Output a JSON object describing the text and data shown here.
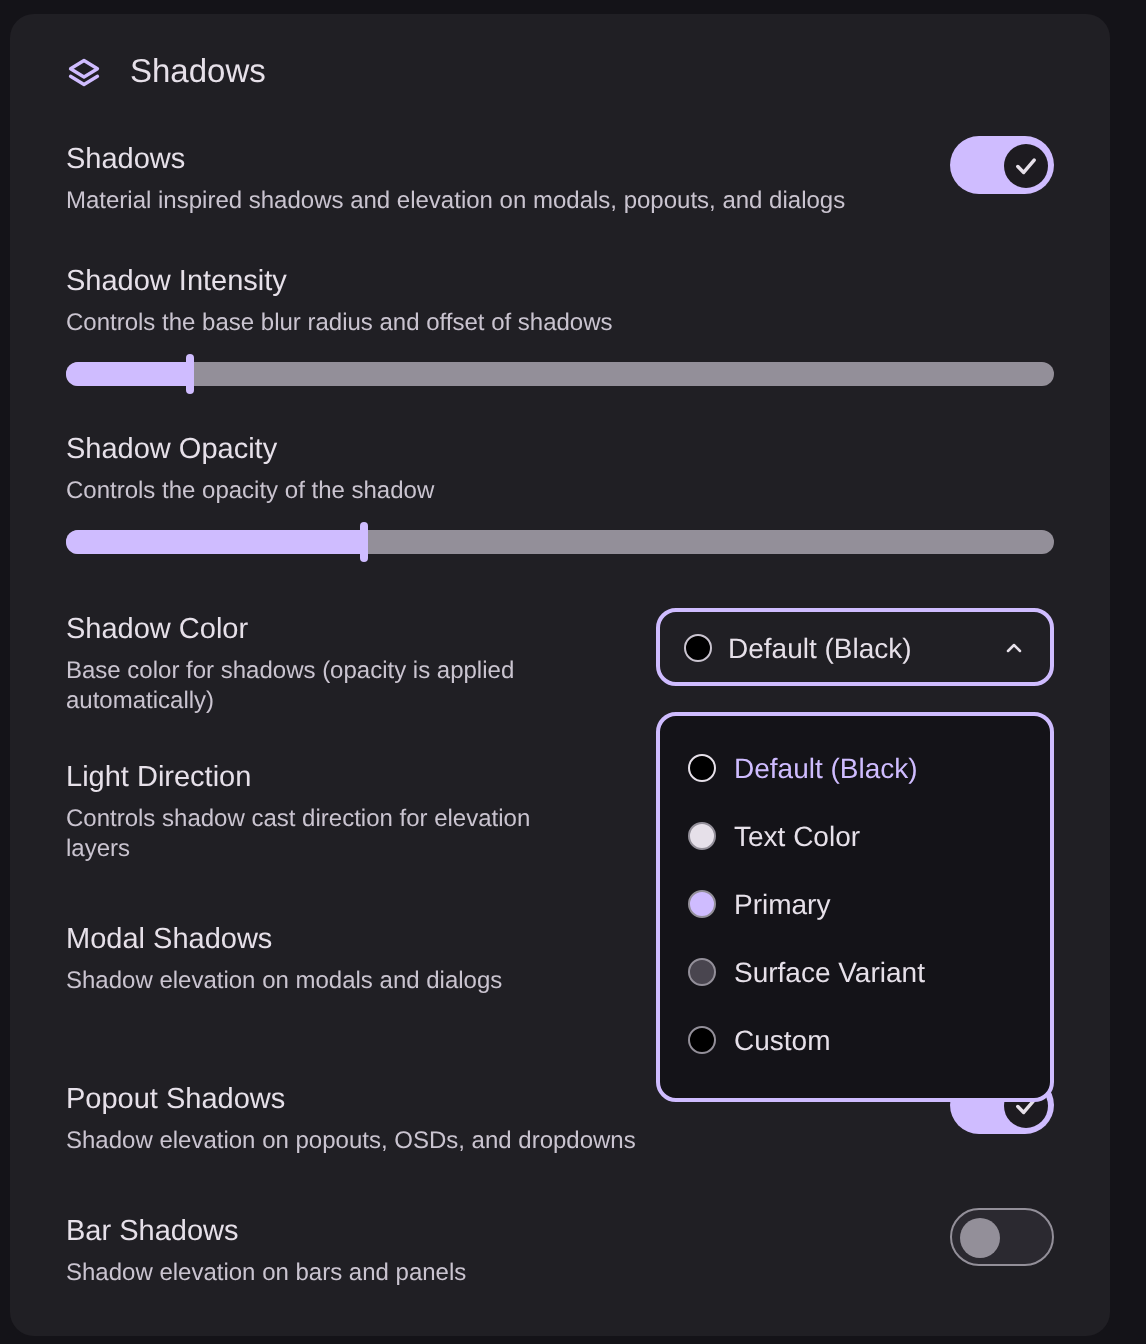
{
  "section": {
    "title": "Shadows"
  },
  "settings": [
    {
      "kind": "toggle",
      "label": "Shadows",
      "description": "Material inspired shadows and elevation on modals, popouts, and dialogs",
      "on": true
    },
    {
      "kind": "slider",
      "label": "Shadow Intensity",
      "description": "Controls the base blur radius and offset of shadows",
      "level": 0.123
    },
    {
      "kind": "slider",
      "label": "Shadow Opacity",
      "description": "Controls the opacity of the shadow",
      "level": 0.3
    },
    {
      "kind": "select",
      "label": "Shadow Color",
      "description": "Base color for shadows (opacity is applied automatically)",
      "value": "Default (Black)",
      "color": "#000000",
      "expanded": true,
      "options": [
        {
          "label": "Default (Black)",
          "color": "#000000",
          "selected": true
        },
        {
          "label": "Text Color",
          "color": "#e6e0e9",
          "selected": false
        },
        {
          "label": "Primary",
          "color": "#cfbcff",
          "selected": false
        },
        {
          "label": "Surface Variant",
          "color": "#49454f",
          "selected": false
        },
        {
          "label": "Custom",
          "color": "#000000",
          "selected": false
        }
      ]
    },
    {
      "kind": "covered",
      "label": "Light Direction",
      "description": "Controls shadow cast direction for elevation layers"
    },
    {
      "kind": "covered",
      "label": "Modal Shadows",
      "description": "Shadow elevation on modals and dialogs"
    },
    {
      "kind": "toggle",
      "label": "Popout Shadows",
      "description": "Shadow elevation on popouts, OSDs, and dropdowns",
      "on": true
    },
    {
      "kind": "toggle",
      "label": "Bar Shadows",
      "description": "Shadow elevation on bars and panels",
      "on": false
    }
  ]
}
